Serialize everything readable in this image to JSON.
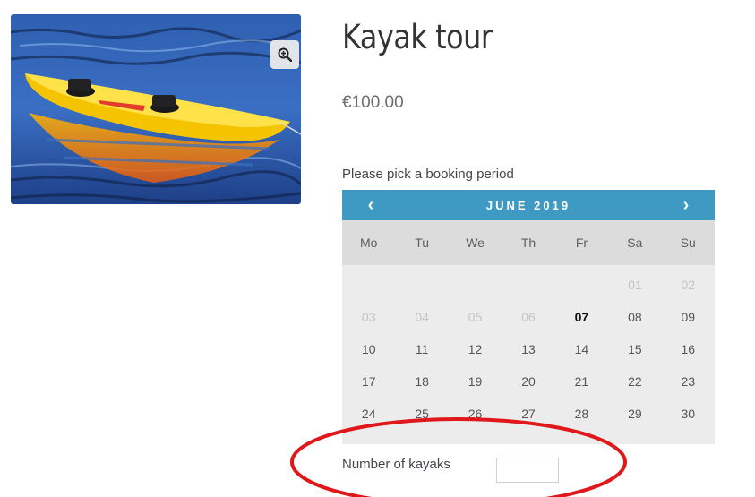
{
  "product": {
    "title": "Kayak tour",
    "price": "€100.00",
    "zoom_icon": "magnifier-plus-icon"
  },
  "booking": {
    "label": "Please pick a booking period",
    "calendar": {
      "month": "JUNE 2019",
      "prev": "‹",
      "next": "›",
      "weekdays": [
        "Mo",
        "Tu",
        "We",
        "Th",
        "Fr",
        "Sa",
        "Su"
      ],
      "days": [
        {
          "d": "",
          "s": "empty"
        },
        {
          "d": "",
          "s": "empty"
        },
        {
          "d": "",
          "s": "empty"
        },
        {
          "d": "",
          "s": "empty"
        },
        {
          "d": "",
          "s": "empty"
        },
        {
          "d": "01",
          "s": "disabled"
        },
        {
          "d": "02",
          "s": "disabled"
        },
        {
          "d": "03",
          "s": "disabled"
        },
        {
          "d": "04",
          "s": "disabled"
        },
        {
          "d": "05",
          "s": "disabled"
        },
        {
          "d": "06",
          "s": "disabled"
        },
        {
          "d": "07",
          "s": "bold"
        },
        {
          "d": "08",
          "s": "avail"
        },
        {
          "d": "09",
          "s": "avail"
        },
        {
          "d": "10",
          "s": "avail"
        },
        {
          "d": "11",
          "s": "avail"
        },
        {
          "d": "12",
          "s": "avail"
        },
        {
          "d": "13",
          "s": "avail"
        },
        {
          "d": "14",
          "s": "avail"
        },
        {
          "d": "15",
          "s": "avail"
        },
        {
          "d": "16",
          "s": "avail"
        },
        {
          "d": "17",
          "s": "avail"
        },
        {
          "d": "18",
          "s": "avail"
        },
        {
          "d": "19",
          "s": "avail"
        },
        {
          "d": "20",
          "s": "avail"
        },
        {
          "d": "21",
          "s": "avail"
        },
        {
          "d": "22",
          "s": "avail"
        },
        {
          "d": "23",
          "s": "avail"
        },
        {
          "d": "24",
          "s": "avail"
        },
        {
          "d": "25",
          "s": "avail"
        },
        {
          "d": "26",
          "s": "avail"
        },
        {
          "d": "27",
          "s": "avail"
        },
        {
          "d": "28",
          "s": "avail"
        },
        {
          "d": "29",
          "s": "avail"
        },
        {
          "d": "30",
          "s": "avail"
        }
      ]
    }
  },
  "quantity": {
    "label": "Number of kayaks",
    "value": ""
  },
  "colors": {
    "calendar_header": "#3e9ac2",
    "annotation_ellipse": "#e0181b"
  }
}
